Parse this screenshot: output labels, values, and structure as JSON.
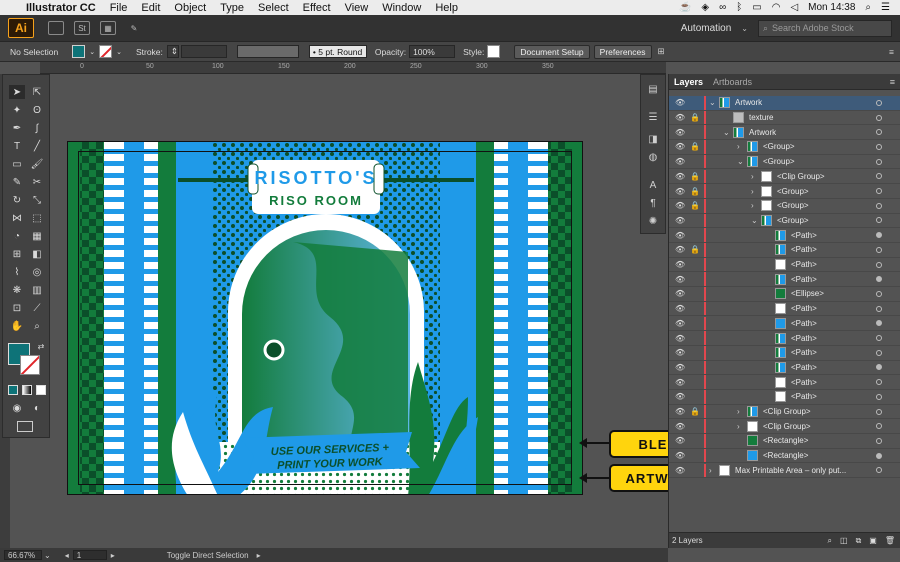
{
  "menubar": {
    "app_name": "Illustrator CC",
    "items": [
      "File",
      "Edit",
      "Object",
      "Type",
      "Select",
      "Effect",
      "View",
      "Window",
      "Help"
    ],
    "clock": "Mon 14:38"
  },
  "appbar": {
    "logo": "Ai",
    "btn_st": "St",
    "workspace": "Automation",
    "stock_placeholder": "Search Adobe Stock"
  },
  "controlbar": {
    "selection": "No Selection",
    "stroke_label": "Stroke:",
    "brush": "5 pt. Round",
    "opacity_label": "Opacity:",
    "opacity_value": "100%",
    "style_label": "Style:",
    "document_setup": "Document Setup",
    "preferences": "Preferences"
  },
  "ruler": {
    "ticks": [
      "0",
      "50",
      "100",
      "150",
      "200",
      "250",
      "300",
      "350"
    ]
  },
  "artwork": {
    "title_line1": "RISOTTO'S",
    "title_line2": "RISO ROOM",
    "banner_line1": "USE OUR SERVICES +",
    "banner_line2": "PRINT YOUR WORK",
    "colors": {
      "green": "#137c3c",
      "blue": "#1f9ae8",
      "white": "#ffffff",
      "dark": "#0b4f2a"
    }
  },
  "callouts": {
    "bleed": "BLEED",
    "artwork": "ARTWORK",
    "color": "#ffd40d"
  },
  "layers_panel": {
    "tab_layers": "Layers",
    "tab_artboards": "Artboards",
    "rows": [
      {
        "name": "Artwork",
        "indent": 0,
        "twirl": "v",
        "locked": false,
        "selected": true,
        "thumb": "art"
      },
      {
        "name": "texture",
        "indent": 1,
        "twirl": "",
        "locked": true,
        "selected": false,
        "thumb": "grey"
      },
      {
        "name": "Artwork",
        "indent": 1,
        "twirl": "v",
        "locked": false,
        "selected": false,
        "thumb": "art"
      },
      {
        "name": "<Group>",
        "indent": 2,
        "twirl": ">",
        "locked": true,
        "selected": false,
        "thumb": "art"
      },
      {
        "name": "<Group>",
        "indent": 2,
        "twirl": "v",
        "locked": false,
        "selected": false,
        "thumb": "art"
      },
      {
        "name": "<Clip Group>",
        "indent": 3,
        "twirl": ">",
        "locked": true,
        "selected": false,
        "thumb": "white"
      },
      {
        "name": "<Group>",
        "indent": 3,
        "twirl": ">",
        "locked": true,
        "selected": false,
        "thumb": "white"
      },
      {
        "name": "<Group>",
        "indent": 3,
        "twirl": ">",
        "locked": true,
        "selected": false,
        "thumb": "white"
      },
      {
        "name": "<Group>",
        "indent": 3,
        "twirl": "v",
        "locked": false,
        "selected": false,
        "thumb": "art"
      },
      {
        "name": "<Path>",
        "indent": 4,
        "twirl": "",
        "locked": false,
        "selected": false,
        "thumb": "art"
      },
      {
        "name": "<Path>",
        "indent": 4,
        "twirl": "",
        "locked": true,
        "selected": false,
        "thumb": "art"
      },
      {
        "name": "<Path>",
        "indent": 4,
        "twirl": "",
        "locked": false,
        "selected": false,
        "thumb": "white"
      },
      {
        "name": "<Path>",
        "indent": 4,
        "twirl": "",
        "locked": false,
        "selected": false,
        "thumb": "art"
      },
      {
        "name": "<Ellipse>",
        "indent": 4,
        "twirl": "",
        "locked": false,
        "selected": false,
        "thumb": "green"
      },
      {
        "name": "<Path>",
        "indent": 4,
        "twirl": "",
        "locked": false,
        "selected": false,
        "thumb": "white"
      },
      {
        "name": "<Path>",
        "indent": 4,
        "twirl": "",
        "locked": false,
        "selected": false,
        "thumb": "blue"
      },
      {
        "name": "<Path>",
        "indent": 4,
        "twirl": "",
        "locked": false,
        "selected": false,
        "thumb": "art"
      },
      {
        "name": "<Path>",
        "indent": 4,
        "twirl": "",
        "locked": false,
        "selected": false,
        "thumb": "art"
      },
      {
        "name": "<Path>",
        "indent": 4,
        "twirl": "",
        "locked": false,
        "selected": false,
        "thumb": "art"
      },
      {
        "name": "<Path>",
        "indent": 4,
        "twirl": "",
        "locked": false,
        "selected": false,
        "thumb": "white"
      },
      {
        "name": "<Path>",
        "indent": 4,
        "twirl": "",
        "locked": false,
        "selected": false,
        "thumb": "white"
      },
      {
        "name": "<Clip Group>",
        "indent": 2,
        "twirl": ">",
        "locked": true,
        "selected": false,
        "thumb": "art"
      },
      {
        "name": "<Clip Group>",
        "indent": 2,
        "twirl": ">",
        "locked": false,
        "selected": false,
        "thumb": "white"
      },
      {
        "name": "<Rectangle>",
        "indent": 2,
        "twirl": "",
        "locked": false,
        "selected": false,
        "thumb": "green"
      },
      {
        "name": "<Rectangle>",
        "indent": 2,
        "twirl": "",
        "locked": false,
        "selected": false,
        "thumb": "blue"
      },
      {
        "name": "Max Printable Area – only put...",
        "indent": 0,
        "twirl": ">",
        "locked": false,
        "selected": false,
        "thumb": "white"
      }
    ],
    "footer": "2 Layers"
  },
  "statusbar": {
    "zoom": "66.67%",
    "artboard_num": "1",
    "status_text": "Toggle Direct Selection"
  }
}
